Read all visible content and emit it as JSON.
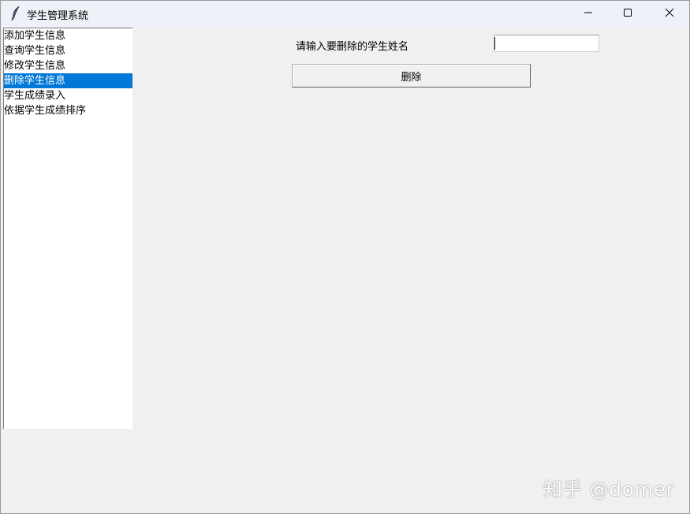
{
  "window": {
    "title": "学生管理系统"
  },
  "icons": {
    "app": "feather-icon",
    "minimize": "minimize-icon",
    "maximize": "maximize-icon",
    "close": "close-icon"
  },
  "sidebar": {
    "items": [
      {
        "label": "添加学生信息"
      },
      {
        "label": "查询学生信息"
      },
      {
        "label": "修改学生信息"
      },
      {
        "label": "删除学生信息"
      },
      {
        "label": "学生成绩录入"
      },
      {
        "label": "依据学生成绩排序"
      }
    ],
    "selected_index": 3
  },
  "form": {
    "label": "请输入要删除的学生姓名",
    "input_value": "",
    "delete_label": "删除"
  },
  "watermark": "知乎 @domer",
  "colors": {
    "selection": "#0078d7",
    "background": "#f0f0f0",
    "titlebar": "#eef1f8"
  }
}
